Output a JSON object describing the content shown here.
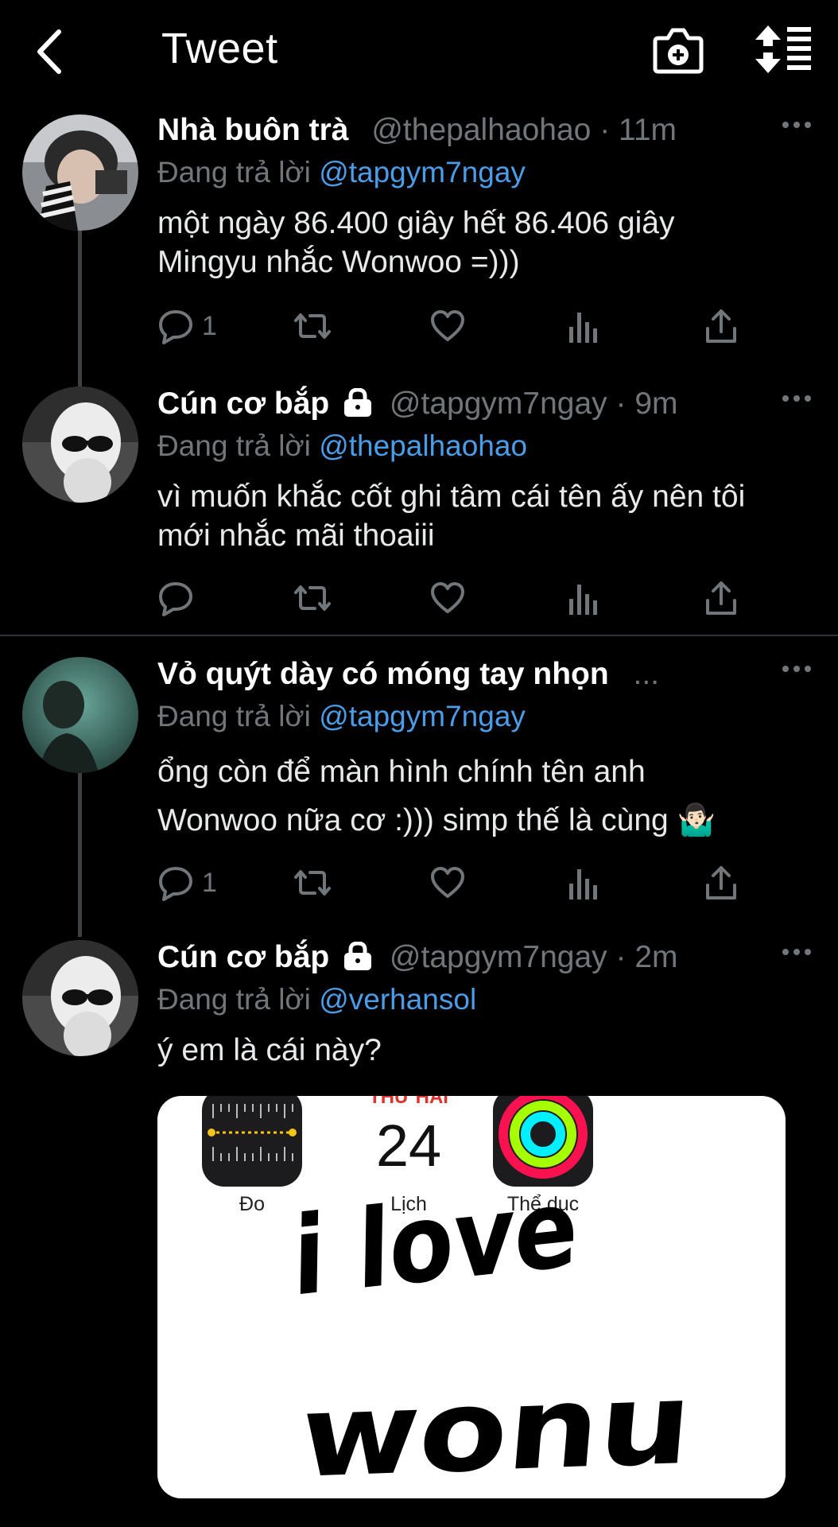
{
  "header": {
    "title": "Tweet"
  },
  "tweets": [
    {
      "name": "Nhà buôn trà",
      "handle": "@thepalhaohao",
      "time": "11m",
      "replying_prefix": "Đang trả lời",
      "replying_to": "@tapgym7ngay",
      "text": "một ngày 86.400 giây hết 86.406 giây Mingyu nhắc Wonwoo =)))",
      "reply_count": "1",
      "locked": false
    },
    {
      "name": "Cún cơ bắp",
      "handle": "@tapgym7ngay",
      "time": "9m",
      "replying_prefix": "Đang trả lời",
      "replying_to": "@thepalhaohao",
      "text": "vì muốn khắc cốt ghi tâm cái tên ấy nên tôi mới nhắc mãi thoaiii",
      "reply_count": "",
      "locked": true
    },
    {
      "name": "Vỏ quýt dày có móng tay nhọn",
      "handle": "...",
      "time": "",
      "replying_prefix": "Đang trả lời",
      "replying_to": "@tapgym7ngay",
      "text": "ổng còn để màn hình chính tên anh Wonwoo nữa cơ :))) simp thế là cùng 🤷🏻‍♂️",
      "reply_count": "1",
      "locked": false
    },
    {
      "name": "Cún cơ bắp",
      "handle": "@tapgym7ngay",
      "time": "2m",
      "replying_prefix": "Đang trả lời",
      "replying_to": "@verhansol",
      "text": "ý em là cái này?",
      "reply_count": "",
      "locked": true
    }
  ],
  "media": {
    "apps": [
      {
        "label": "Đo",
        "icon": "measure-icon"
      },
      {
        "label": "Lịch",
        "icon": "calendar-icon"
      },
      {
        "label": "Thể dục",
        "icon": "fitness-rings-icon"
      }
    ],
    "calendar_weekday": "THỨ HAI",
    "calendar_date": "24",
    "line1": "i love",
    "line2": "wonu"
  },
  "colors": {
    "background": "#000000",
    "mention": "#4a9de8",
    "secondary_text": "#71767b",
    "thread_line": "#3e4144"
  }
}
